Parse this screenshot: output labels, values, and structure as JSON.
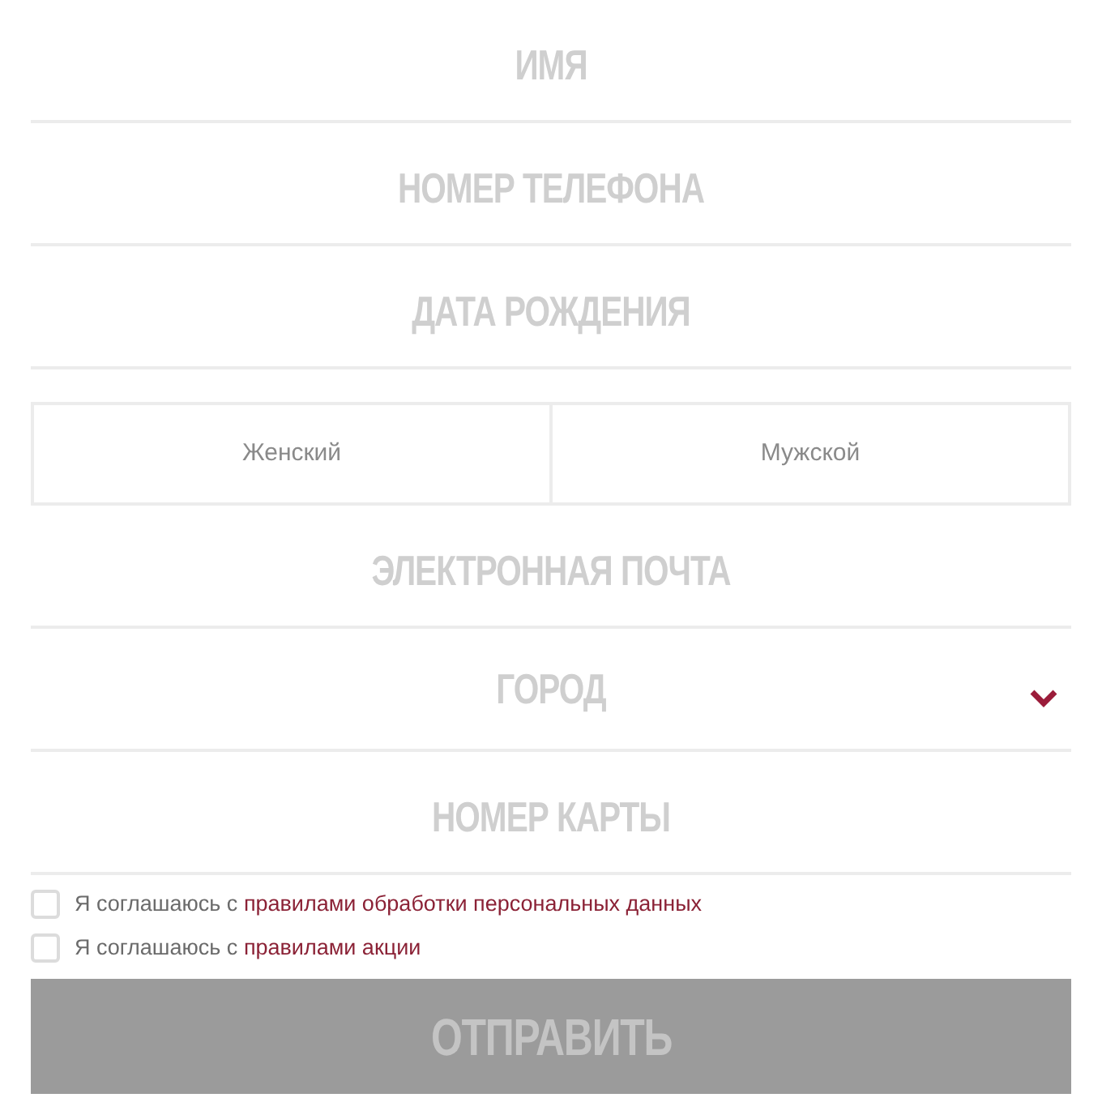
{
  "fields": [
    {
      "kind": "text",
      "placeholder": "ИМЯ"
    },
    {
      "kind": "text",
      "placeholder": "НОМЕР ТЕЛЕФОНА"
    },
    {
      "kind": "text",
      "placeholder": "ДАТА РОЖДЕНИЯ"
    },
    {
      "kind": "gender",
      "options": [
        {
          "label": "Женский",
          "selected": false
        },
        {
          "label": "Мужской",
          "selected": false
        }
      ]
    },
    {
      "kind": "text",
      "placeholder": "ЭЛЕКТРОННАЯ ПОЧТА"
    },
    {
      "kind": "select",
      "placeholder": "ГОРОД"
    },
    {
      "kind": "text",
      "placeholder": "НОМЕР КАРТЫ"
    }
  ],
  "agreements": [
    {
      "text": "Я соглашаюсь с",
      "link": "правилами обработки персональных данных",
      "checked": false
    },
    {
      "text": "Я соглашаюсь с",
      "link": "правилами акции",
      "checked": false
    }
  ],
  "submit": {
    "label": "ОТПРАВИТЬ",
    "disabled": true
  }
}
